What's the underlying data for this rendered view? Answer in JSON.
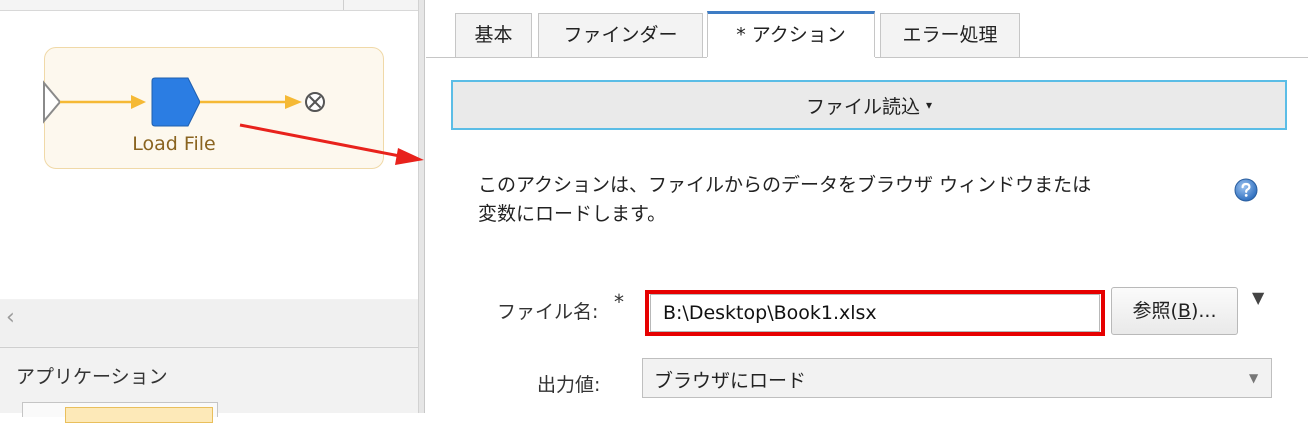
{
  "flow": {
    "step_label": "Load File"
  },
  "left_panel": {
    "applications_header": "アプリケーション",
    "scroll_left_glyph": "‹"
  },
  "tabs": [
    {
      "label": "基本",
      "active": false
    },
    {
      "label": "ファインダー",
      "active": false
    },
    {
      "label": "* アクション",
      "active": true
    },
    {
      "label": "エラー処理",
      "active": false
    }
  ],
  "action": {
    "selector_label": "ファイル読込",
    "caret": "▾",
    "description": "このアクションは、ファイルからのデータをブラウザ ウィンドウまたは\n変数にロードします。"
  },
  "form": {
    "filename_label": "ファイル名:",
    "required_mark": "*",
    "filename_value": "B:\\Desktop\\Book1.xlsx",
    "browse_label_prefix": "参照(",
    "browse_label_key": "B",
    "browse_label_suffix": ")...",
    "filename_menu_glyph": "▼",
    "output_label": "出力値:",
    "output_value": "ブラウザにロード",
    "output_caret": "▼"
  },
  "colors": {
    "accent_tab": "#3e7cc4",
    "selector_border": "#5bbde6",
    "highlight_red": "#e60000",
    "flow_line": "#f5b935",
    "step_node": "#2b7de3",
    "annotation_arrow": "#e8221c"
  },
  "icons": {
    "help": "question-circle-icon",
    "end": "circle-x-icon",
    "start": "triangle-start-icon"
  }
}
